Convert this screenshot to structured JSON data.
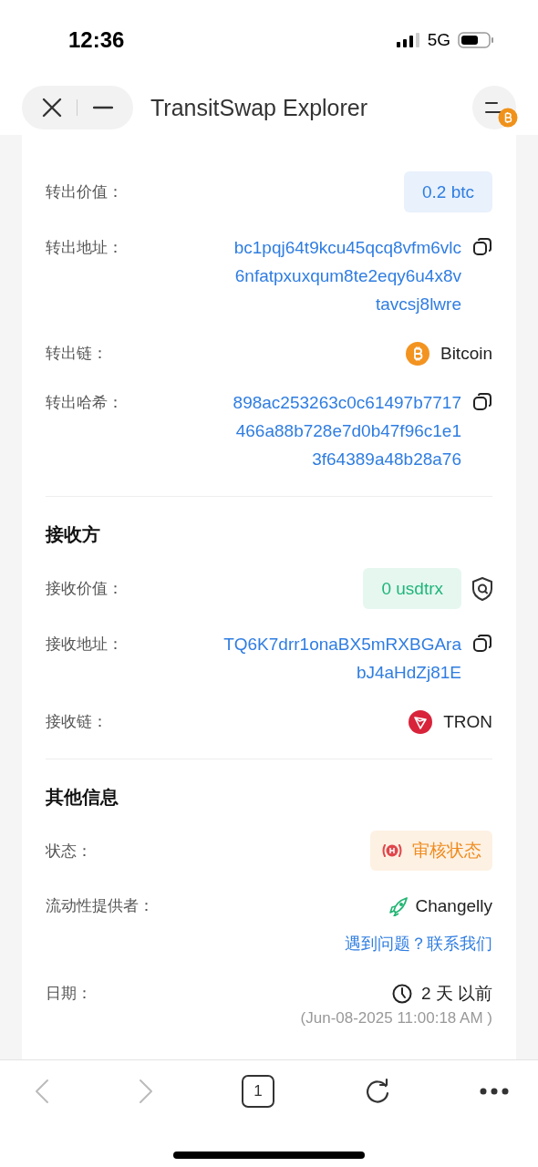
{
  "status_bar": {
    "time": "12:36",
    "network": "5G"
  },
  "browser": {
    "title": "TransitSwap Explorer"
  },
  "sections": [
    {
      "rows": [
        {
          "kind": "amount",
          "label": "转出价值：",
          "value": "0.2 btc",
          "color": "#2f7de1"
        },
        {
          "kind": "address",
          "label": "转出地址：",
          "lines": [
            "bc1pqj64t9kcu45qcq8vfm6vlc",
            "6nfatpxuxqum8te2eqy6u4x8v",
            "tavcsj8lwre"
          ]
        },
        {
          "kind": "chain",
          "label": "转出链：",
          "value": "Bitcoin"
        },
        {
          "kind": "address",
          "label": "转出哈希：",
          "lines": [
            "898ac253263c0c61497b7717",
            "466a88b728e7d0b47f96c1e1",
            "3f64389a48b28a76"
          ]
        }
      ]
    },
    {
      "title": "接收方",
      "rows": [
        {
          "kind": "amount",
          "label": "接收价值：",
          "value": "0 usdtrx",
          "color": "#1fb57a",
          "shield": true
        },
        {
          "kind": "address",
          "label": "接收地址：",
          "lines": [
            "TQ6K7drr1onaBX5mRXBGAra",
            "bJ4aHdZj81E"
          ]
        },
        {
          "kind": "chain",
          "label": "接收链：",
          "value": "TRON"
        }
      ]
    },
    {
      "title": "其他信息",
      "rows": [
        {
          "kind": "status",
          "label": "状态：",
          "value": "审核状态",
          "color": "#f08a1c"
        },
        {
          "kind": "provider",
          "label": "流动性提供者：",
          "value": "Changelly",
          "link": "遇到问题？联系我们"
        },
        {
          "kind": "date",
          "label": "日期：",
          "value": "2 天 以前",
          "detail": "(Jun-08-2025 11:00:18 AM )"
        }
      ]
    }
  ],
  "toolbar": {
    "back": {
      "disabled": true
    },
    "forward": {
      "disabled": true
    },
    "tab_count": "1"
  }
}
